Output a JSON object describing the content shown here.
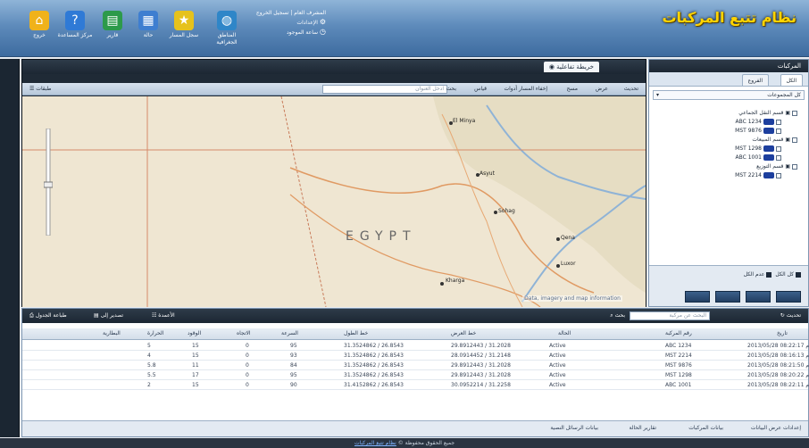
{
  "header": {
    "app_title": "نظام تتبع المركبات",
    "toolbar": [
      {
        "label": "خروج",
        "icon": "home-icon",
        "color": "#f0b21a"
      },
      {
        "label": "مركز المساعدة",
        "icon": "help-icon",
        "color": "#2f7ad6"
      },
      {
        "label": "قارير",
        "icon": "report-icon",
        "color": "#2d9a4b"
      },
      {
        "label": "حالة",
        "icon": "status-icon",
        "color": "#3e7ed0"
      },
      {
        "label": "سجل المسار",
        "icon": "star-icon",
        "color": "#e6c21c"
      },
      {
        "label": "المناطق الجغرافية",
        "icon": "globe-icon",
        "color": "#2f86c8"
      }
    ],
    "user_line1": "المشرف العام | تسجيل الخروج",
    "user_line2": "الإعدادات",
    "user_line3": "ساعة الموجود"
  },
  "map": {
    "tab_label": "خريطة تفاعلية",
    "toolbar": [
      "تحديث",
      "عرض",
      "مسح",
      "إخفاء المسار",
      "أدوات",
      "قياس",
      "بحث"
    ],
    "search_placeholder": "ادخل العنوان",
    "layers_label": "طبقات",
    "country_label": "EGYPT",
    "cities": [
      "El Minya",
      "Asyut",
      "Sohag",
      "Qena",
      "Luxor",
      "Kharga"
    ],
    "attribution": "Data, imagery and map information"
  },
  "vehicles": {
    "title": "المركبات",
    "tabs": [
      "الكل",
      "الفروع"
    ],
    "group_select": "كل المجموعات",
    "tree": [
      {
        "label": "قسم النقل الجماعي",
        "type": "group"
      },
      {
        "label": "ABC 1234",
        "type": "vehicle"
      },
      {
        "label": "MST 9876",
        "type": "vehicle"
      },
      {
        "label": "قسم المبيعات",
        "type": "group"
      },
      {
        "label": "MST 1298",
        "type": "vehicle"
      },
      {
        "label": "ABC 1001",
        "type": "vehicle"
      },
      {
        "label": "قسم التوزيع",
        "type": "group"
      },
      {
        "label": "MST 2214",
        "type": "vehicle"
      }
    ],
    "check_label_1": "كل الكل",
    "check_label_2": "عدم الكل"
  },
  "grid": {
    "toolbar": {
      "refresh": "تحديث",
      "search_placeholder": "البحث عن مركبة",
      "search_button": "بحث",
      "columns": "الأعمدة",
      "export": "تصدير إلى",
      "print": "طباعة الجدول"
    },
    "headers": [
      "تاريخ",
      "رقم المركبة",
      "الحالة",
      "خط العرض",
      "خط الطول",
      "السرعة",
      "الاتجاه",
      "الوقود",
      "الحرارة",
      "البطارية"
    ],
    "rows": [
      [
        "2013/05/28 08:22:17 م",
        "ABC 1234",
        "Active",
        "29.8912443 / 31.2028",
        "31.3524862 / 26.8543",
        "95",
        "0",
        "15",
        "5"
      ],
      [
        "2013/05/28 08:16:13 م",
        "MST 2214",
        "Active",
        "28.0914452 / 31.2148",
        "31.3524862 / 26.8543",
        "93",
        "0",
        "15",
        "4"
      ],
      [
        "2013/05/28 08:21:50 م",
        "MST 9876",
        "Active",
        "29.8912443 / 31.2028",
        "31.3524862 / 26.8543",
        "84",
        "0",
        "11",
        "5.8"
      ],
      [
        "2013/05/28 08:20:22 م",
        "MST 1298",
        "Active",
        "29.8912443 / 31.2028",
        "31.3524862 / 26.8543",
        "95",
        "0",
        "17",
        "5.5"
      ],
      [
        "2013/05/28 08:22:11 م",
        "ABC 1001",
        "Active",
        "30.0952214 / 31.2258",
        "31.4152862 / 26.8543",
        "90",
        "0",
        "15",
        "2"
      ]
    ],
    "footer": [
      "إعدادات عرض البيانات",
      "بيانات المركبات",
      "تقارير الحالة",
      "بيانات الرسائل النصية"
    ]
  },
  "footer": {
    "text": "جميع الحقوق محفوظة ©",
    "link": "نظام تتبع المركبات"
  },
  "colors": {
    "title_yellow": "#ffd400",
    "header_blue": "#5e8bbb",
    "dark_panel": "#1f2a36",
    "plate_blue": "#1d3f9e"
  }
}
